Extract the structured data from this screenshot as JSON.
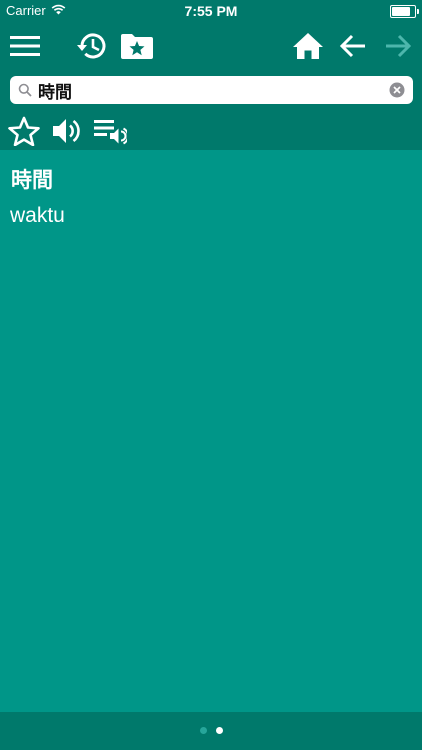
{
  "status_bar": {
    "carrier": "Carrier",
    "time": "7:55 PM",
    "battery_level": 0.9
  },
  "toolbar": {
    "icons": [
      "menu-icon",
      "history-icon",
      "favorites-folder-icon",
      "home-icon",
      "back-arrow-icon",
      "forward-arrow-icon"
    ]
  },
  "search": {
    "value": "時間",
    "icons": [
      "search-icon",
      "clear-icon"
    ]
  },
  "actions": {
    "icons": [
      "star-icon",
      "speaker-icon",
      "speak-list-icon"
    ]
  },
  "entry": {
    "word": "時間",
    "translation": "waktu"
  },
  "pager": {
    "pages": 2,
    "current": 2
  },
  "colors": {
    "primary_dark": "#00796b",
    "primary": "#009688",
    "text": "#ffffff"
  }
}
